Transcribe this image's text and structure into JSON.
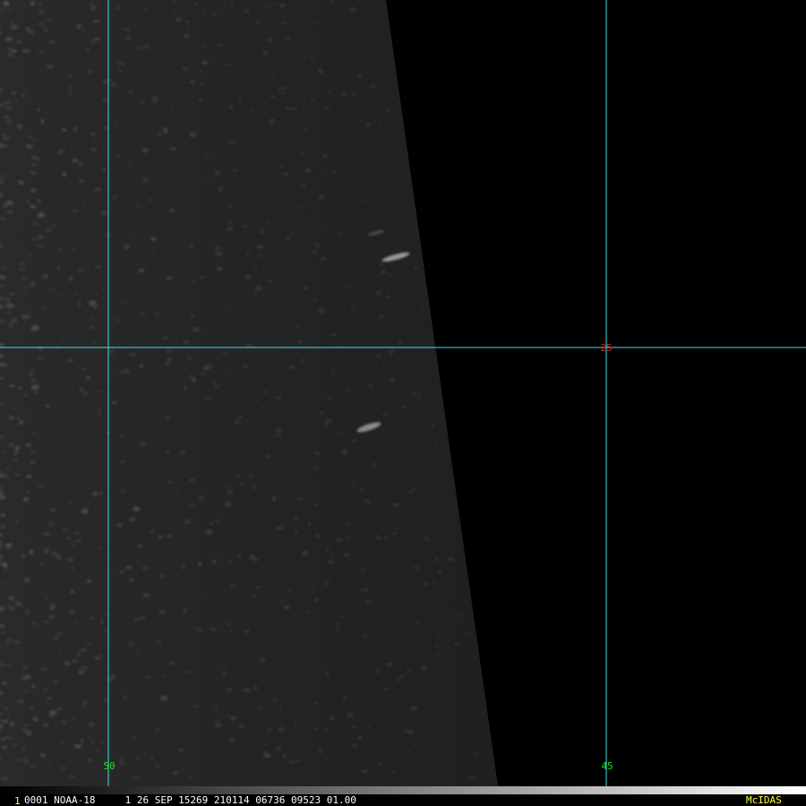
{
  "image": {
    "grid": {
      "line_color": "#40e0e0",
      "latitude_labels": [
        {
          "text": "25",
          "color": "#e02020"
        }
      ],
      "longitude_labels": [
        {
          "text": "50",
          "color": "#20e020"
        },
        {
          "text": "45",
          "color": "#20e020"
        }
      ]
    }
  },
  "status_bar": {
    "frame_number": "1",
    "frame_color": "#ffff40",
    "info": "0001 NOAA-18     1 26 SEP 15269 210114 06736 09523 01.00",
    "info_color": "#ffffff",
    "brand": "McIDAS",
    "brand_color": "#ffff40"
  }
}
